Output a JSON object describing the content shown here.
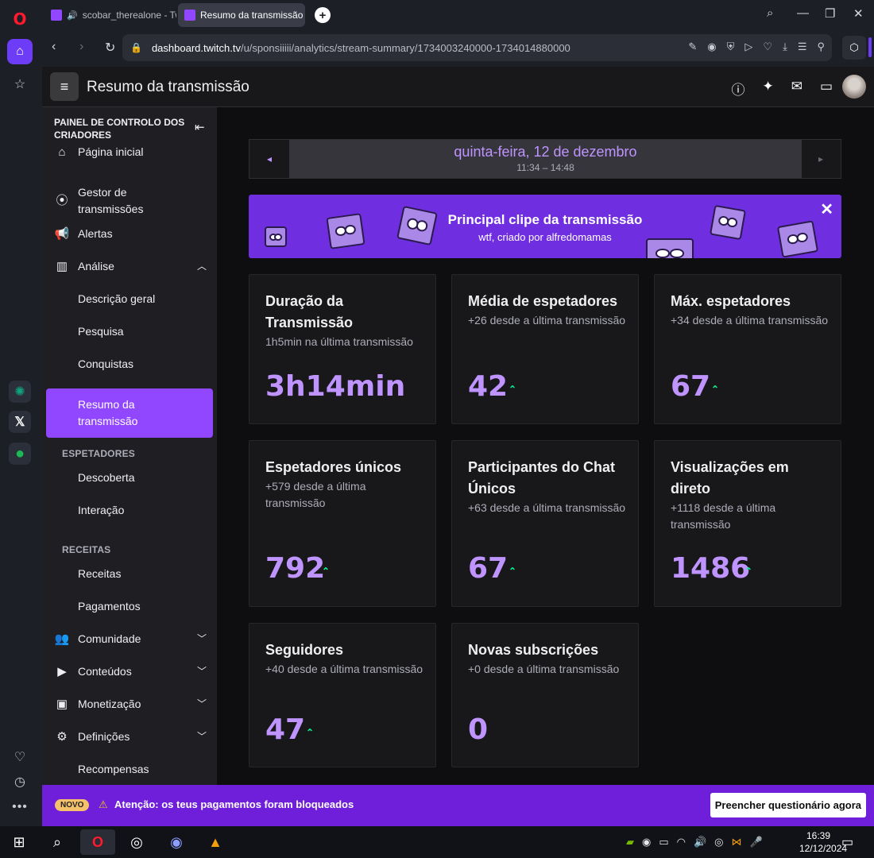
{
  "browser": {
    "tabs": [
      {
        "title": "scobar_therealone - Tw"
      },
      {
        "title": "Resumo da transmissão - T"
      }
    ],
    "url_host": "dashboard.twitch.tv",
    "url_path": "/u/sponsiiiii/analytics/stream-summary/1734003240000-1734014880000"
  },
  "header": {
    "title": "Resumo da transmissão"
  },
  "sidenav": {
    "title": "PAINEL DE CONTROLO DOS CRIADORES",
    "items": {
      "home": "Página inicial",
      "stream_manager": "Gestor de transmissões",
      "alerts": "Alertas",
      "analysis": "Análise",
      "overview": "Descrição geral",
      "search": "Pesquisa",
      "achievements": "Conquistas",
      "stream_summary": "Resumo da transmissão",
      "discovery": "Descoberta",
      "interaction": "Interação",
      "revenue": "Receitas",
      "payments": "Pagamentos",
      "community": "Comunidade",
      "content": "Conteúdos",
      "monetization": "Monetização",
      "settings": "Definições",
      "rewards": "Recompensas"
    },
    "sections": {
      "viewers": "ESPETADORES",
      "revenue": "RECEITAS"
    }
  },
  "datebar": {
    "day": "quinta-feira, 12 de dezembro",
    "time": "11:34 – 14:48"
  },
  "banner": {
    "title": "Principal clipe da transmissão",
    "subtitle": "wtf, criado por alfredomamas"
  },
  "cards": {
    "duration": {
      "title": "Duração da Transmissão",
      "sub": "1h5min na última transmissão",
      "value": "3h14min"
    },
    "avg_viewers": {
      "title": "Média de espetadores",
      "sub": "+26 desde a última transmissão",
      "value": "42"
    },
    "max_viewers": {
      "title": "Máx. espetadores",
      "sub": "+34 desde a última transmissão",
      "value": "67"
    },
    "unique_viewers": {
      "title": "Espetadores únicos",
      "sub": "+579 desde a última transmissão",
      "value": "792"
    },
    "chat_participants": {
      "title": "Participantes do Chat Únicos",
      "sub": "+63 desde a última transmissão",
      "value": "67"
    },
    "live_views": {
      "title": "Visualizações em direto",
      "sub": "+1118 desde a última transmissão",
      "value": "1486"
    },
    "followers": {
      "title": "Seguidores",
      "sub": "+40 desde a última transmissão",
      "value": "47"
    },
    "new_subs": {
      "title": "Novas subscrições",
      "sub": "+0 desde a última transmissão",
      "value": "0"
    }
  },
  "notice": {
    "badge": "NOVO",
    "text": "Atenção: os teus pagamentos foram bloqueados",
    "button": "Preencher questionário agora"
  },
  "taskbar": {
    "time": "16:39",
    "date": "12/12/2024"
  },
  "colors": {
    "accent": "#9147ff",
    "value": "#bf94ff",
    "up": "#00f593",
    "banner": "#6f2fe0",
    "notice": "#6f1fd9"
  }
}
